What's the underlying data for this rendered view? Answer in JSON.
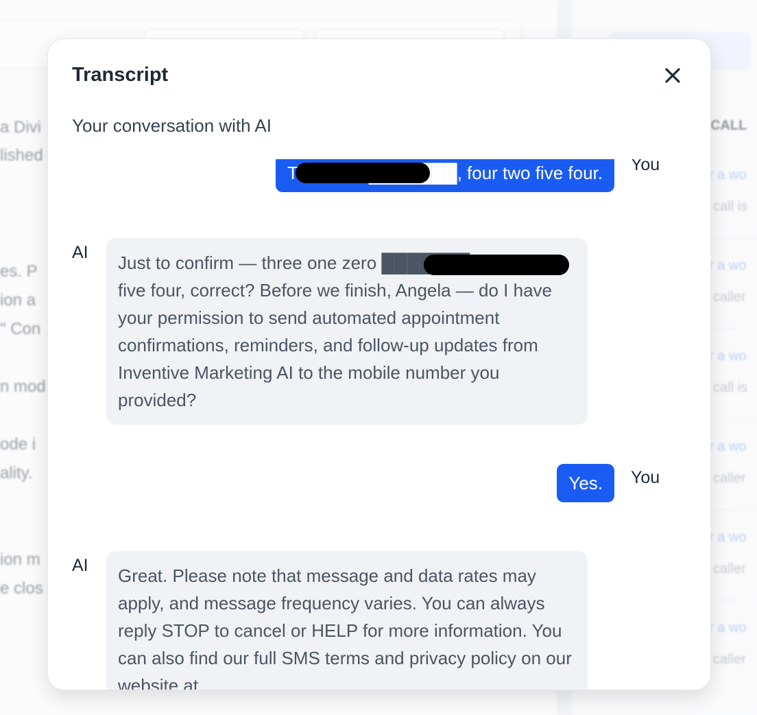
{
  "modal": {
    "title": "Transcript",
    "subtitle": "Your conversation with AI",
    "close_icon": "close-icon"
  },
  "messages": [
    {
      "speaker": "You",
      "text": "Three ten ███████, four two five four."
    },
    {
      "speaker": "AI",
      "text": "Just to confirm — three one zero ███████ - four two five four, correct? Before we finish, Angela — do I have your permission to send automated appointment confirmations, reminders, and follow-up updates from Inventive Marketing AI to the mobile number you provided?"
    },
    {
      "speaker": "You",
      "text": "Yes."
    },
    {
      "speaker": "AI",
      "text": "Great. Please note that message and data rates may apply, and message frequency varies. You can always reply STOP to cancel or HELP for more information. You can also find our full SMS terms and privacy policy on our website at"
    }
  ],
  "colors": {
    "user_bubble": "#1a5cf2",
    "ai_bubble": "#f0f2f5",
    "accent": "#1a5cf2"
  }
}
